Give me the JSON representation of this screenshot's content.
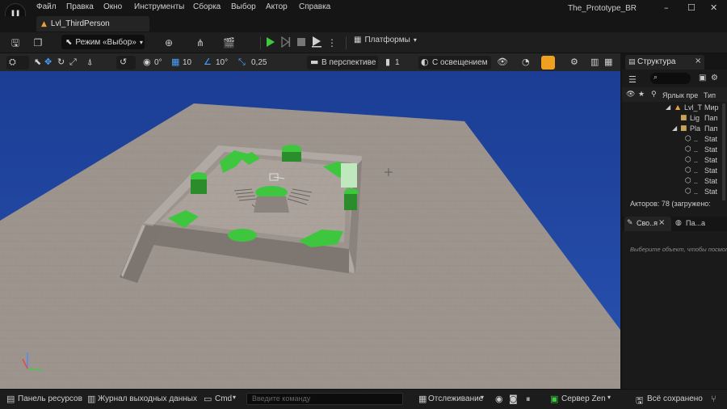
{
  "menu": {
    "items": [
      "Файл",
      "Правка",
      "Окно",
      "Инструменты",
      "Сборка",
      "Выбор",
      "Актор",
      "Справка"
    ],
    "project_name": "The_Prototype_BR"
  },
  "tab": {
    "level_name": "Lvl_ThirdPerson"
  },
  "toolbar": {
    "mode_label": "Режим «Выбор»",
    "platforms_label": "Платформы"
  },
  "viewport_toolbar": {
    "rotation_snap": "0°",
    "grid_snap": "10",
    "angle_snap": "10°",
    "scale_snap": "0,25",
    "view_mode": "В перспективе",
    "camera_speed": "1",
    "lighting_mode": "С освещением"
  },
  "outliner": {
    "title": "Структура",
    "col_label": "Ярлык пре",
    "col_type": "Тип",
    "rows": [
      {
        "label": "Lvl_T",
        "type": "Мир"
      },
      {
        "label": "Lig",
        "type": "Пап"
      },
      {
        "label": "Pla",
        "type": "Пап"
      },
      {
        "label": "..",
        "type": "Stat"
      },
      {
        "label": "..",
        "type": "Stat"
      },
      {
        "label": "..",
        "type": "Stat"
      },
      {
        "label": "..",
        "type": "Stat"
      },
      {
        "label": "..",
        "type": "Stat"
      },
      {
        "label": "..",
        "type": "Stat"
      }
    ],
    "actor_count": "Акторов: 78 (загружено:"
  },
  "details": {
    "tab1": "Сво..я",
    "tab2": "Па...а",
    "hint": "Выберите объект, чтобы посмотр"
  },
  "bottom": {
    "content_browser": "Панель ресурсов",
    "output_log": "Журнал выходных данных",
    "cmd": "Cmd",
    "cmd_placeholder": "Введите команду",
    "trace": "Отслеживание",
    "zen": "Сервер Zen",
    "saved": "Всё сохранено"
  },
  "colors": {
    "sky": "#1d3f96",
    "ground": "#9c948d",
    "accent_green": "#2ea44f",
    "play_green": "#3ec93e",
    "highlight_orange": "#f0a020"
  }
}
